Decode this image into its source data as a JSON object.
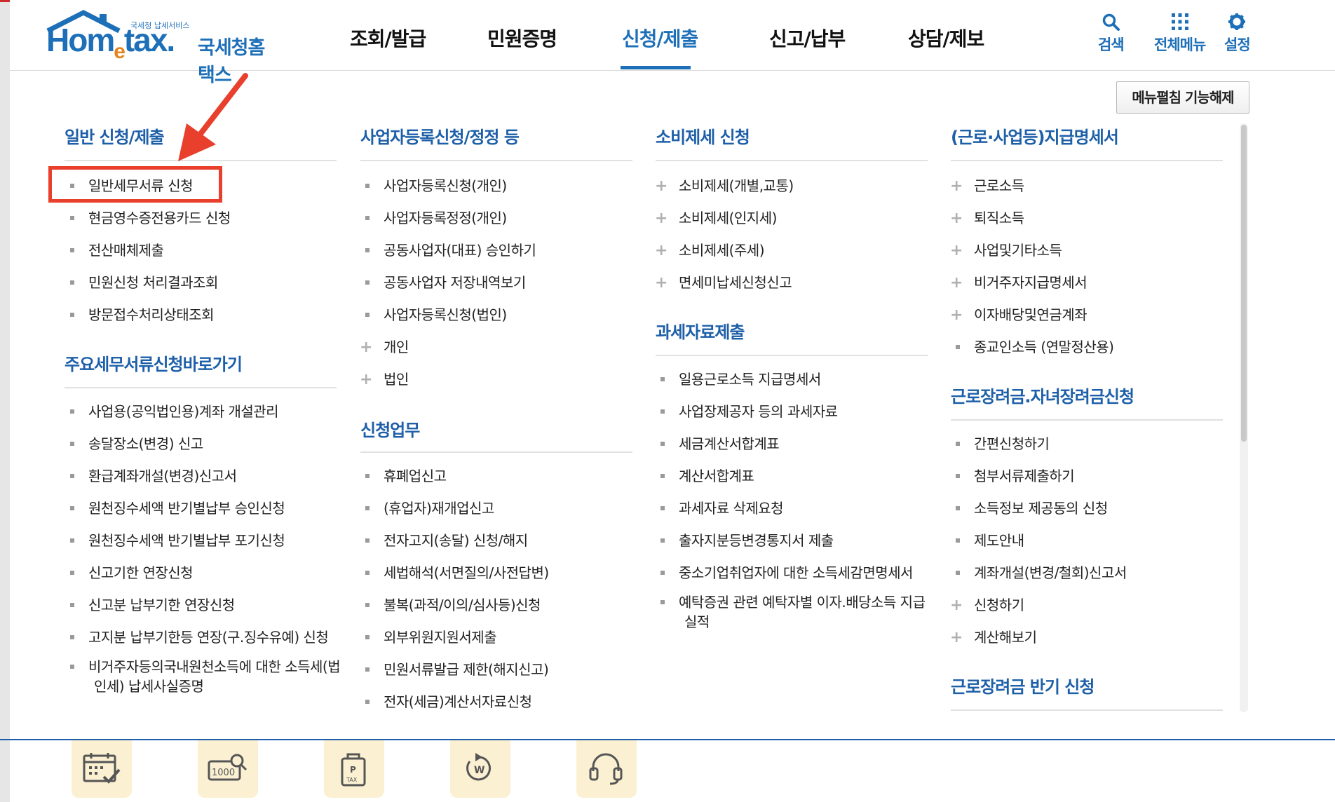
{
  "header": {
    "logo_small": "국세청 납세서비스",
    "logo_home": "Hom",
    "logo_e": "e",
    "logo_tax": "tax.",
    "logo_kor": "국세청홈택스",
    "nav": [
      "조회/발급",
      "민원증명",
      "신청/제출",
      "신고/납부",
      "상담/제보"
    ],
    "active_nav": "신청/제출",
    "utils": {
      "search": "검색",
      "all_menu": "전체메뉴",
      "settings": "설정"
    },
    "accent": "#1d6fb8"
  },
  "unpin_button": "메뉴펼침 기능해제",
  "col1": {
    "title1": "일반 신청/제출",
    "items1": [
      "일반세무서류 신청",
      "현금영수증전용카드 신청",
      "전산매체제출",
      "민원신청 처리결과조회",
      "방문접수처리상태조회"
    ],
    "title2": "주요세무서류신청바로가기",
    "items2": [
      "사업용(공익법인용)계좌 개설관리",
      "송달장소(변경) 신고",
      "환급계좌개설(변경)신고서",
      "원천징수세액 반기별납부 승인신청",
      "원천징수세액 반기별납부 포기신청",
      "신고기한 연장신청",
      "신고분 납부기한 연장신청",
      "고지분 납부기한등 연장(구.징수유예) 신청",
      "비거주자등의국내원천소득에 대한 소득세(법인세) 납세사실증명"
    ]
  },
  "col2": {
    "title1": "사업자등록신청/정정 등",
    "items1": [
      "사업자등록신청(개인)",
      "사업자등록정정(개인)",
      "공동사업자(대표) 승인하기",
      "공동사업자 저장내역보기",
      "사업자등록신청(법인)"
    ],
    "plus1": [
      "개인",
      "법인"
    ],
    "title2": "신청업무",
    "items2": [
      "휴폐업신고",
      "(휴업자)재개업신고",
      "전자고지(송달) 신청/해지",
      "세법해석(서면질의/사전답변)",
      "불복(과적/이의/심사등)신청",
      "외부위원지원서제출",
      "민원서류발급 제한(해지신고)",
      "전자(세금)계산서자료신청"
    ]
  },
  "col3": {
    "title1": "소비제세 신청",
    "plus1": [
      "소비제세(개별,교통)",
      "소비제세(인지세)",
      "소비제세(주세)",
      "면세미납세신청신고"
    ],
    "title2": "과세자료제출",
    "items2": [
      "일용근로소득 지급명세서",
      "사업장제공자 등의 과세자료",
      "세금계산서합계표",
      "계산서합계표",
      "과세자료 삭제요청",
      "출자지분등변경통지서 제출",
      "중소기업취업자에 대한 소득세감면명세서",
      "예탁증권 관련 예탁자별 이자.배당소득 지급실적"
    ]
  },
  "col4": {
    "title1": "(근로·사업등)지급명세서",
    "plus1": [
      "근로소득",
      "퇴직소득",
      "사업및기타소득",
      "비거주자지급명세서",
      "이자배당및연금계좌"
    ],
    "items1": [
      "종교인소득 (연말정산용)"
    ],
    "title2": "근로장려금.자녀장려금신청",
    "items2": [
      "간편신청하기",
      "첨부서류제출하기",
      "소득정보 제공동의 신청",
      "제도안내",
      "계좌개설(변경/철회)신고서"
    ],
    "plus2": [
      "신청하기",
      "계산해보기"
    ],
    "title3": "근로장려금 반기 신청"
  },
  "quick_icons": [
    "calendar-check-icon",
    "receipt-search-icon",
    "tax-bag-icon",
    "refund-won-icon",
    "headset-icon"
  ]
}
